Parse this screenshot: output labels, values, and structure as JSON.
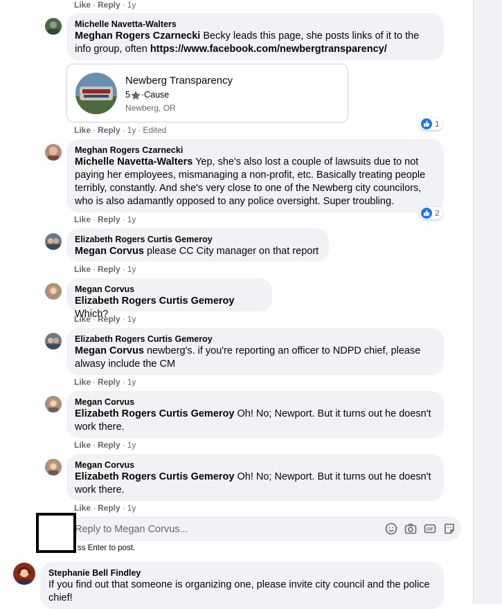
{
  "colors": {
    "bubble": "#f0f2f5",
    "like_blue": "#1877f2",
    "meta_gray": "#65676b"
  },
  "actions": {
    "like": "Like",
    "reply": "Reply",
    "time": "1y",
    "edited": "Edited"
  },
  "comments": [
    {
      "author": "Michelle Navetta-Walters",
      "tag": "Meghan Rogers Czarnecki",
      "text": " Becky leads this page, she posts links of it to the info group, often ",
      "link": "https://www.facebook.com/newbergtransparency/"
    },
    {
      "author": "Meghan Rogers Czarnecki",
      "tag": "Michelle Navetta-Walters",
      "text": " Yep, she's also lost a couple of lawsuits due to not paying her employees, mismanaging a non-profit, etc. Basically treating people terribly, constantly. And she's very close to one of the Newberg city councilors, who is also adamantly opposed to any police oversight. Super troubling.",
      "reactions": "2"
    },
    {
      "author": "Elizabeth Rogers Curtis Gemeroy",
      "tag": "Megan Corvus",
      "text": " please CC City manager on that report"
    },
    {
      "author": "Megan Corvus",
      "tag": "Elizabeth Rogers Curtis Gemeroy",
      "text": " Which?"
    },
    {
      "author": "Elizabeth Rogers Curtis Gemeroy",
      "tag": "Megan Corvus",
      "text": " newberg's. if you're reporting an officer to NDPD chief, please alwasy include the CM"
    },
    {
      "author": "Megan Corvus",
      "tag": "Elizabeth Rogers Curtis Gemeroy",
      "text": " Oh! No; Newport. But it turns out he doesn't work there."
    },
    {
      "author": "Megan Corvus",
      "tag": "Elizabeth Rogers Curtis Gemeroy",
      "text": " Oh! No; Newport. But it turns out he doesn't work there."
    }
  ],
  "link_card": {
    "title": "Newberg Transparency",
    "rating": "5",
    "category": "Cause",
    "location": "Newberg, OR",
    "reactions": "1"
  },
  "reply_box": {
    "placeholder": "Reply to Megan Corvus...",
    "hint": "ss Enter to post."
  },
  "bottom_comment": {
    "author": "Stephanie Bell Findley",
    "text": "If you find out that someone is organizing one, please invite city council and the police chief!"
  }
}
